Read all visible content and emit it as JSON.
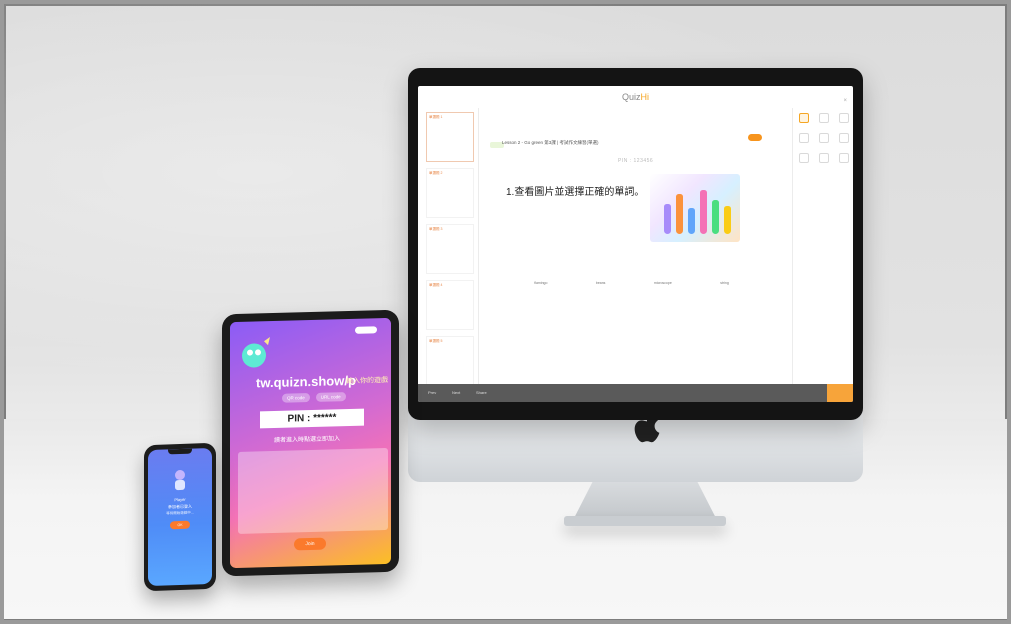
{
  "imac": {
    "app": {
      "brand": "Quiz",
      "brand_accent": "Hi",
      "close": "×"
    },
    "topic": "Lesson 2 - Go green 第3課 | 考試作文練習(單選)",
    "pin": "PIN : 123456",
    "question": "1.查看圖片並選擇正確的單詞。",
    "slides": [
      "單選題 1",
      "單選題 2",
      "單選題 3",
      "單選題 4",
      "單選題 5"
    ],
    "answers": [
      "flamingo",
      "beans",
      "microscope",
      "string"
    ],
    "bottom": {
      "prev": "Prev",
      "next": "Next",
      "share": "Share",
      "go": "Go"
    },
    "colors": {
      "accent": "#f5a623",
      "bottom_bar": "#5a5a5a"
    }
  },
  "ipad": {
    "url": "tw.quizn.show/p",
    "url_suffix": "輸入你的遊戲",
    "pill_left": "QR code",
    "pill_right": "URL code",
    "pin": "PIN : ******",
    "hint": "讀者進入時點選立即加入",
    "button": "Join"
  },
  "iphone": {
    "line1": "Player",
    "line2": "參加者已登入",
    "line3": "等待開始遊戲中...",
    "button": "OK"
  }
}
